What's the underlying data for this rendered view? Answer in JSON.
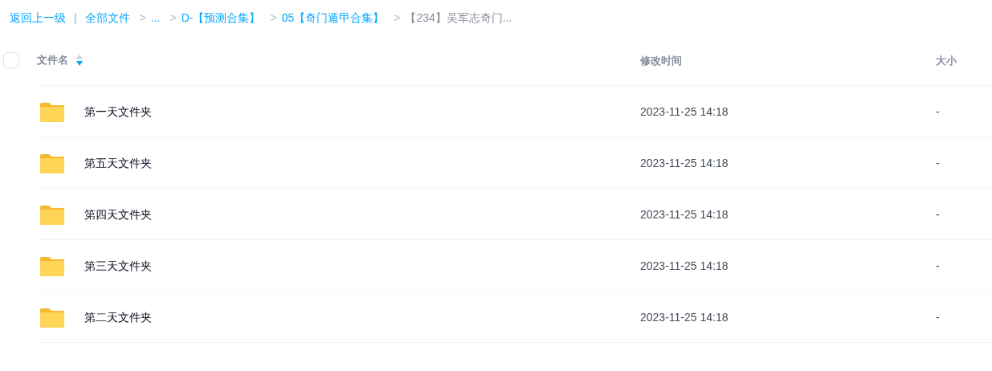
{
  "breadcrumb": {
    "back": "返回上一级",
    "divider": "|",
    "items": [
      {
        "label": "全部文件",
        "current": false
      },
      {
        "separator": ">",
        "label": "...",
        "current": false
      },
      {
        "separator": ">",
        "label": "D-【预测合集】",
        "current": false
      },
      {
        "separator": ">",
        "label": "05【奇门遁甲合集】",
        "current": false
      },
      {
        "separator": ">",
        "label": "【234】吴军志奇门...",
        "current": true
      }
    ]
  },
  "table": {
    "select_all": {
      "checked": false
    },
    "columns": [
      "文件名",
      "修改时间",
      "大小"
    ],
    "rows": [
      {
        "name": "第一天文件夹",
        "modified": "2023-11-25 14:18",
        "size": "-"
      },
      {
        "name": "第五天文件夹",
        "modified": "2023-11-25 14:18",
        "size": "-"
      },
      {
        "name": "第四天文件夹",
        "modified": "2023-11-25 14:18",
        "size": "-"
      },
      {
        "name": "第三天文件夹",
        "modified": "2023-11-25 14:18",
        "size": "-"
      },
      {
        "name": "第二天文件夹",
        "modified": "2023-11-25 14:18",
        "size": "-"
      }
    ]
  }
}
